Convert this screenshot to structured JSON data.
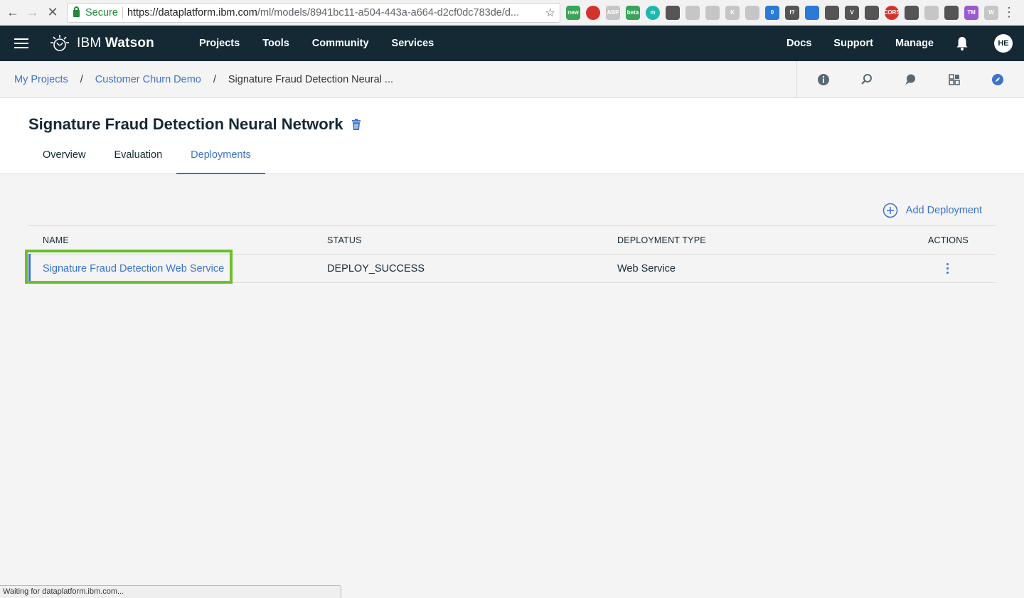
{
  "browser": {
    "secure_label": "Secure",
    "url_host": "https://dataplatform.ibm.com",
    "url_path": "/ml/models/8941bc11-a504-443a-a664-d2cf0dc783de/d...",
    "extensions": [
      "new",
      "",
      "ABP",
      "beta",
      "m",
      "",
      "",
      "",
      "K",
      "",
      "0",
      "f?",
      "",
      "",
      "V",
      "",
      "CORS",
      "",
      "",
      "",
      "TM",
      "W"
    ]
  },
  "header": {
    "brand_prefix": "IBM ",
    "brand_name": "Watson",
    "nav": [
      "Projects",
      "Tools",
      "Community",
      "Services"
    ],
    "right_nav": [
      "Docs",
      "Support",
      "Manage"
    ],
    "avatar_initials": "HE"
  },
  "breadcrumb": {
    "items": [
      "My Projects",
      "Customer Churn Demo"
    ],
    "current": "Signature Fraud Detection Neural ...",
    "separator": "/"
  },
  "page": {
    "title": "Signature Fraud Detection Neural Network",
    "tabs": [
      "Overview",
      "Evaluation",
      "Deployments"
    ],
    "active_tab": "Deployments"
  },
  "deployments": {
    "add_label": "Add Deployment",
    "columns": [
      "NAME",
      "STATUS",
      "DEPLOYMENT TYPE",
      "ACTIONS"
    ],
    "rows": [
      {
        "name": "Signature Fraud Detection Web Service",
        "status": "DEPLOY_SUCCESS",
        "type": "Web Service"
      }
    ]
  },
  "status_bar": "Waiting for dataplatform.ibm.com...",
  "colors": {
    "header_bg": "#152935",
    "link": "#3b73c9",
    "highlight": "#6bbf2a"
  }
}
